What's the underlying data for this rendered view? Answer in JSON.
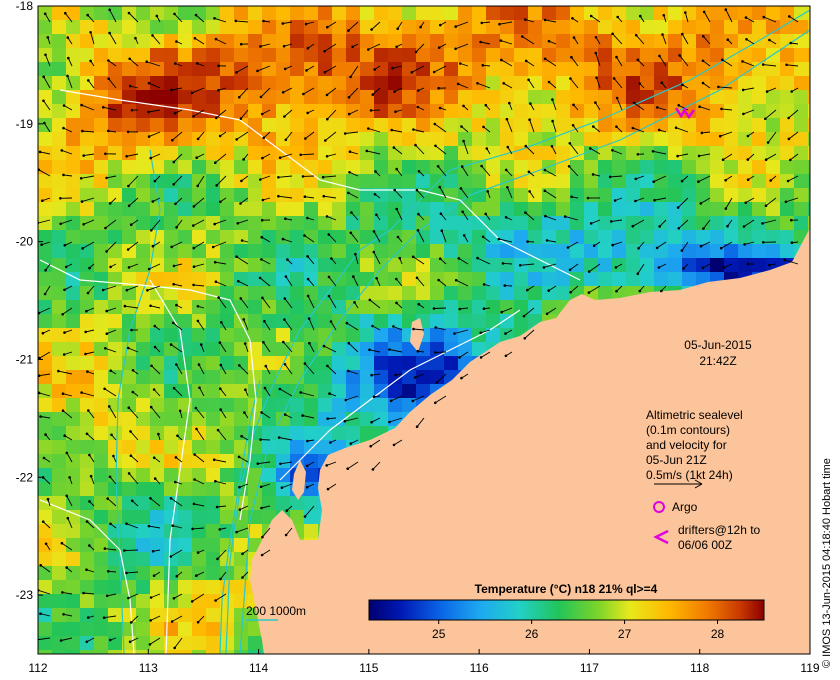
{
  "map": {
    "lon_min": 112,
    "lon_max": 119,
    "lat_min": -23.5,
    "lat_max": -18,
    "lon_ticks": [
      "112",
      "113",
      "114",
      "115",
      "116",
      "117",
      "118",
      "119"
    ],
    "lat_ticks": [
      "-18",
      "-19",
      "-20",
      "-21",
      "-22",
      "-23"
    ]
  },
  "annotations": {
    "date": "05-Jun-2015",
    "time": "21:42Z",
    "altimetry": [
      "Altimetric sealevel",
      "(0.1m contours)",
      "and velocity for",
      "05-Jun 21Z",
      "0.5m/s (1kt 24h)"
    ],
    "argo": "Argo",
    "drifters": [
      "drifters@12h to",
      "06/06 00Z"
    ],
    "bathymetry": "200  1000m",
    "credit": "© IMOS 13-Jun-2015 04:18:40 Hobart time"
  },
  "colorbar": {
    "title": "Temperature (°C) n18 21% ql>=4",
    "min": 24.25,
    "max": 28.5,
    "ticks": [
      "25",
      "26",
      "27",
      "28"
    ],
    "tick_values": [
      25,
      26,
      27,
      28
    ]
  },
  "colors": {
    "land": "#fcc49a",
    "contour": "#ffffff",
    "bathy": "#28c8c8",
    "argo": "#e000e0",
    "drifter": "#e000e0"
  }
}
